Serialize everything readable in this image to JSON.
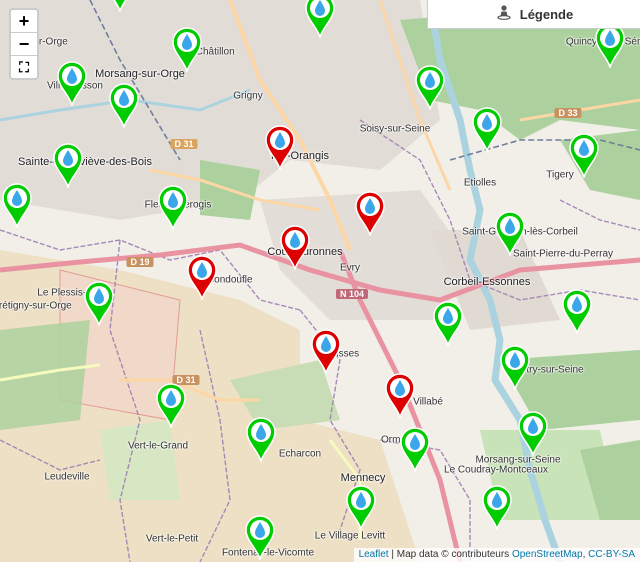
{
  "legend": {
    "label": "Légende",
    "icon": "person-pin-icon"
  },
  "zoom": {
    "in": "+",
    "out": "−",
    "fullscreen": "⛶"
  },
  "attribution": {
    "leaflet": "Leaflet",
    "sep": " | Map data © contributeurs ",
    "osm": "OpenStreetMap",
    "comma": ", ",
    "license": "CC-BY-SA"
  },
  "places": [
    "lay-sur-Orge",
    "Morsang-sur-Orge",
    "Villemoisson",
    "Viry-Châtillon",
    "Grigny",
    "Sainte-Geneviève-des-Bois",
    "Fleury-Mérogis",
    "Ris-Orangis",
    "Soisy-sur-Seine",
    "Etiolles",
    "Tigery",
    "Saint-Germain-lès-Corbeil",
    "Courcouronnes",
    "Evry",
    "Corbeil-Essonnes",
    "Bondoufle",
    "Le Plessis-Pâté",
    "Brétigny-sur-Orge",
    "Lisses",
    "Villabé",
    "Saint-Pierre-du-Perray",
    "Vert-le-Grand",
    "Echarcon",
    "Ormoy",
    "Morsang-sur-Seine",
    "Le Coudray-Montceaux",
    "Mennecy",
    "Leudeville",
    "Le Village Levitt",
    "Vert-le-Petit",
    "Fontenay-le-Vicomte",
    "Saintry-sur-Seine",
    "Quincy-sous-Sénart"
  ],
  "roads": [
    "D 31",
    "D 19",
    "D 31",
    "N 104",
    "D 33"
  ],
  "markers": [
    {
      "status": "ok",
      "color": "#00cc00"
    },
    {
      "status": "ok",
      "color": "#00cc00"
    },
    {
      "status": "ok",
      "color": "#00cc00"
    },
    {
      "status": "ok",
      "color": "#00cc00"
    },
    {
      "status": "ok",
      "color": "#00cc00"
    },
    {
      "status": "ok",
      "color": "#00cc00"
    },
    {
      "status": "ok",
      "color": "#00cc00"
    },
    {
      "status": "ok",
      "color": "#00cc00"
    },
    {
      "status": "ok",
      "color": "#00cc00"
    },
    {
      "status": "ok",
      "color": "#00cc00"
    },
    {
      "status": "ok",
      "color": "#00cc00"
    },
    {
      "status": "ok",
      "color": "#00cc00"
    },
    {
      "status": "alert",
      "color": "#dd0000"
    },
    {
      "status": "alert",
      "color": "#dd0000"
    },
    {
      "status": "alert",
      "color": "#dd0000"
    },
    {
      "status": "alert",
      "color": "#dd0000"
    },
    {
      "status": "alert",
      "color": "#dd0000"
    },
    {
      "status": "alert",
      "color": "#dd0000"
    },
    {
      "status": "ok",
      "color": "#00cc00"
    },
    {
      "status": "ok",
      "color": "#00cc00"
    },
    {
      "status": "ok",
      "color": "#00cc00"
    },
    {
      "status": "ok",
      "color": "#00cc00"
    },
    {
      "status": "ok",
      "color": "#00cc00"
    },
    {
      "status": "ok",
      "color": "#00cc00"
    },
    {
      "status": "ok",
      "color": "#00cc00"
    },
    {
      "status": "ok",
      "color": "#00cc00"
    },
    {
      "status": "ok",
      "color": "#00cc00"
    },
    {
      "status": "ok",
      "color": "#00cc00"
    },
    {
      "status": "ok",
      "color": "#00cc00"
    },
    {
      "status": "ok",
      "color": "#00cc00"
    },
    {
      "status": "ok",
      "color": "#00cc00"
    }
  ]
}
